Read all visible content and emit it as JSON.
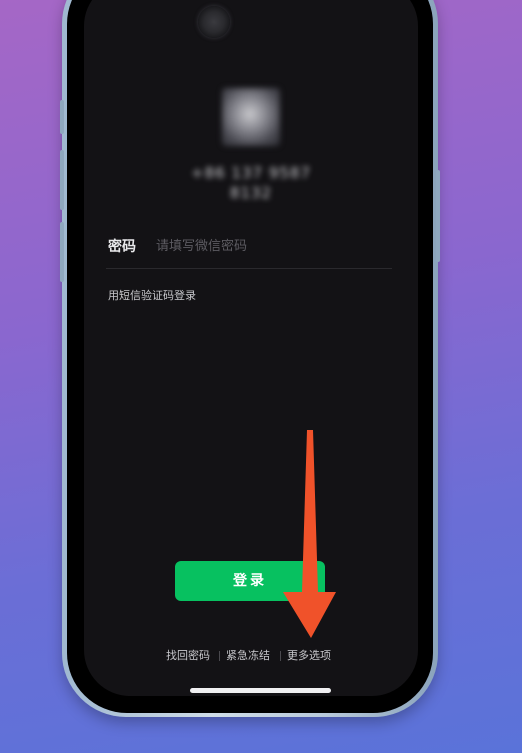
{
  "profile": {
    "phone_number": "+86 137 9587 8132"
  },
  "password": {
    "label": "密码",
    "placeholder": "请填写微信密码"
  },
  "sms_login": {
    "label": "用短信验证码登录"
  },
  "login_button": {
    "label": "登录",
    "color": "#07c160"
  },
  "footer": {
    "links": [
      {
        "label": "找回密码"
      },
      {
        "label": "紧急冻结"
      },
      {
        "label": "更多选项"
      }
    ]
  },
  "annotation": {
    "arrow_color": "#f0522a",
    "arrow_points_to": "更多选项"
  }
}
